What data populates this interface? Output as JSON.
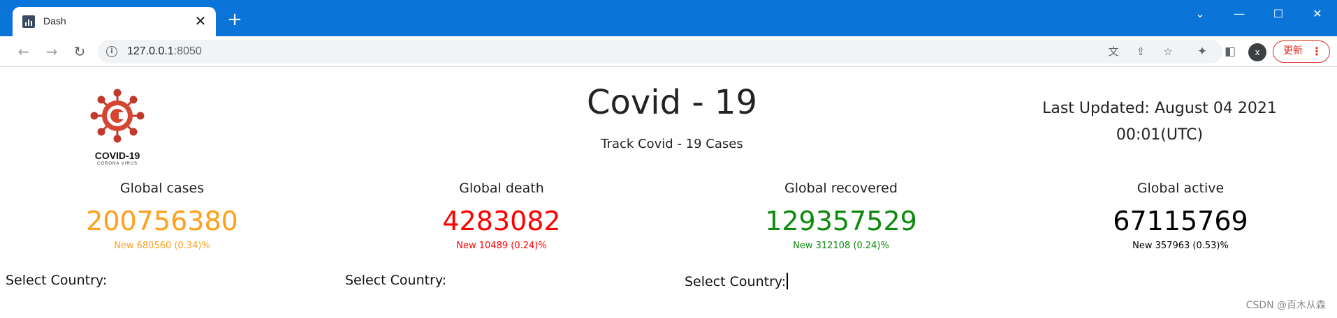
{
  "browser": {
    "tab_title": "Dash",
    "tab_close": "✕",
    "new_tab": "+",
    "url_host": "127.0.0.1",
    "url_port": ":8050",
    "avatar_letter": "x",
    "update_label": "更新",
    "update_menu": "⋮",
    "accent_color": "#0a74d8"
  },
  "header": {
    "logo_text": "COVID-19",
    "logo_sub": "CORONA VIRUS",
    "title": "Covid - 19",
    "subtitle": "Track Covid - 19 Cases",
    "last_updated_line1": "Last Updated: August 04 2021",
    "last_updated_line2": "00:01(UTC)"
  },
  "stats": [
    {
      "label": "Global cases",
      "value": "200756380",
      "new": "New 680560 (0.34)%",
      "color": "#ff9f1a"
    },
    {
      "label": "Global death",
      "value": "4283082",
      "new": "New 10489 (0.24)%",
      "color": "#ff0000"
    },
    {
      "label": "Global recovered",
      "value": "129357529",
      "new": "New 312108 (0.24)%",
      "color": "#0b8a0b"
    },
    {
      "label": "Global active",
      "value": "67115769",
      "new": "New 357963 (0.53)%",
      "color": "#000000"
    }
  ],
  "selectors": [
    {
      "label": "Select Country:"
    },
    {
      "label": "Select Country:"
    },
    {
      "label": "Select Country:"
    }
  ],
  "watermark": "CSDN @百木从森"
}
